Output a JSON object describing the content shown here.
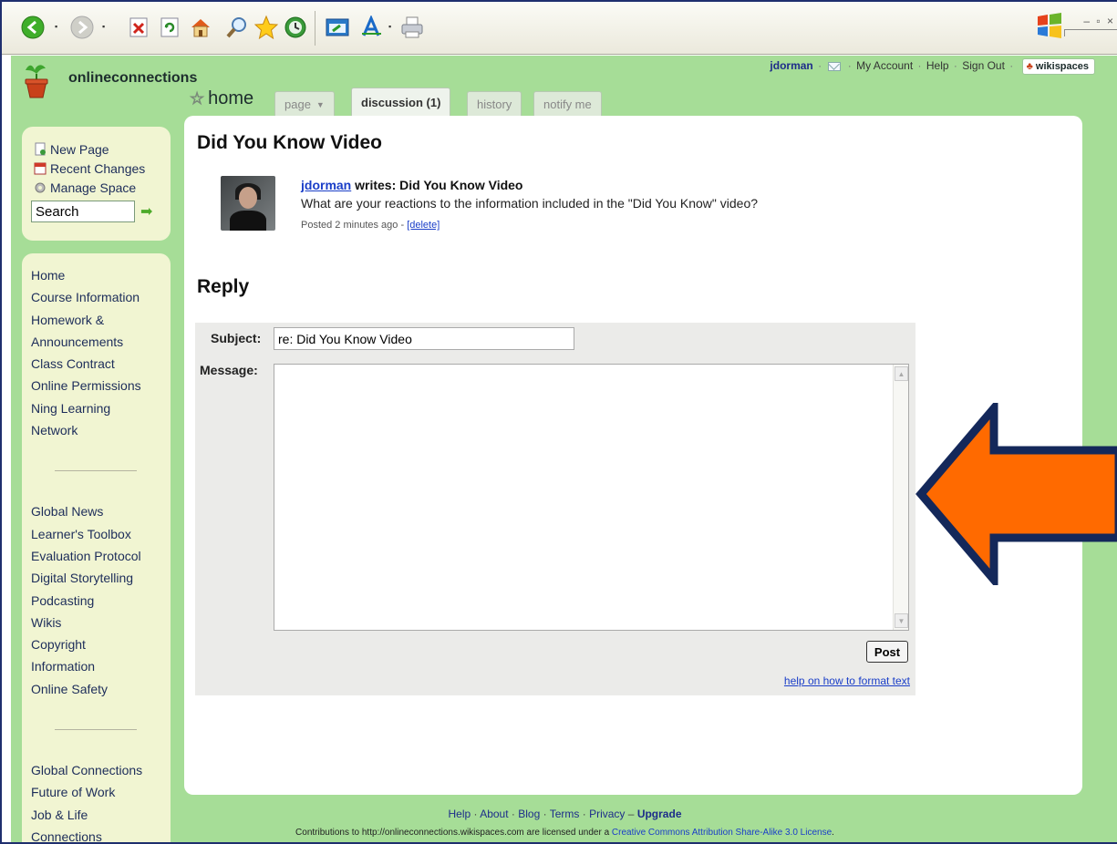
{
  "toolbar": {
    "icons": [
      "back-icon",
      "forward-icon",
      "stop-icon",
      "refresh-icon",
      "home-icon",
      "search-icon",
      "favorites-icon",
      "history-icon",
      "media-icon",
      "font-icon",
      "print-icon"
    ]
  },
  "site": {
    "name": "onlineconnections",
    "brand": "wikispaces"
  },
  "userbar": {
    "username": "jdorman",
    "my_account": "My Account",
    "help": "Help",
    "sign_out": "Sign Out"
  },
  "tabs": {
    "home_title": "home",
    "page": "page",
    "discussion": "discussion (1)",
    "history": "history",
    "notify": "notify me"
  },
  "tools": {
    "new_page": "New Page",
    "recent_changes": "Recent Changes",
    "manage_space": "Manage Space",
    "search_value": "Search"
  },
  "nav": {
    "group1": [
      "Home",
      "Course Information",
      "Homework &",
      "Announcements",
      "Class Contract",
      "Online Permissions",
      "Ning Learning",
      "Network"
    ],
    "group2": [
      "Global News",
      "Learner's Toolbox",
      "Evaluation Protocol",
      "Digital Storytelling",
      "Podcasting",
      "Wikis",
      "Copyright",
      "Information",
      "Online Safety"
    ],
    "group3": [
      "Global Connections",
      "Future of Work",
      "Job & Life",
      "Connections"
    ]
  },
  "discussion": {
    "title": "Did You Know Video",
    "author": "jdorman",
    "writes": " writes: Did You Know Video",
    "body": "What are your reactions to the information included in the \"Did You Know\" video?",
    "posted": "Posted 2 minutes ago - ",
    "delete": "[delete]"
  },
  "reply": {
    "title": "Reply",
    "subject_label": "Subject:",
    "subject_value": "re: Did You Know Video",
    "message_label": "Message:",
    "post_button": "Post",
    "help_link": "help on how to format text"
  },
  "footer": {
    "help": "Help",
    "about": "About",
    "blog": "Blog",
    "terms": "Terms",
    "privacy": "Privacy",
    "upgrade": "Upgrade",
    "license_prefix": "Contributions to http://onlineconnections.wikispaces.com are licensed under a ",
    "license_link": "Creative Commons Attribution Share-Alike 3.0 License",
    "license_suffix": "."
  },
  "colors": {
    "page_bg": "#a6dd97",
    "sidebar_bg": "#f1f5d2",
    "link": "#1a3ec8",
    "arrow_fill": "#ff6a00",
    "arrow_outline": "#14285a"
  }
}
